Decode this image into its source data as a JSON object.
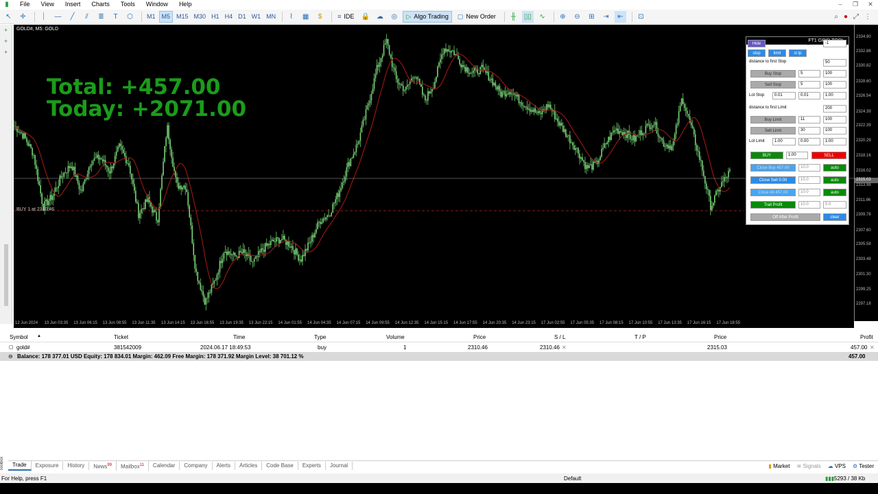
{
  "menu": [
    "File",
    "View",
    "Insert",
    "Charts",
    "Tools",
    "Window",
    "Help"
  ],
  "timeframes": [
    "M1",
    "M5",
    "M15",
    "M30",
    "H1",
    "H4",
    "D1",
    "W1",
    "MN"
  ],
  "active_timeframe": "M5",
  "toolbar": {
    "algo_trading": "Algo Trading",
    "new_order": "New Order",
    "ide": "IDE"
  },
  "chart": {
    "symbol_label": "GOLD#, M5:  GOLD",
    "total": "Total: +457.00",
    "today": "Today: +2071.00",
    "buy_line_label": "BUY 1 at 2310.46",
    "current_price_tag": "2315.03"
  },
  "chart_data": {
    "type": "candlestick",
    "y_ticks": [
      "2334.90",
      "2332.88",
      "2330.82",
      "2328.60",
      "2326.54",
      "2324.39",
      "2322.39",
      "2320.29",
      "2318.16",
      "2316.02",
      "2313.98",
      "2311.86",
      "2309.78",
      "2307.60",
      "2305.58",
      "2303.48",
      "2301.30",
      "2299.25",
      "2297.18"
    ],
    "x_ticks": [
      "12 Jun 2024",
      "13 Jun 03:35",
      "13 Jun 06:15",
      "13 Jun 08:55",
      "13 Jun 11:35",
      "13 Jun 14:15",
      "13 Jun 16:55",
      "13 Jun 19:35",
      "13 Jun 22:15",
      "14 Jun 01:55",
      "14 Jun 04:35",
      "14 Jun 07:15",
      "14 Jun 09:55",
      "14 Jun 12:35",
      "14 Jun 15:15",
      "14 Jun 17:55",
      "14 Jun 20:35",
      "14 Jun 23:15",
      "17 Jun 02:55",
      "17 Jun 05:35",
      "17 Jun 08:15",
      "17 Jun 10:55",
      "17 Jun 13:35",
      "17 Jun 16:15",
      "17 Jun 18:55"
    ],
    "close_path": [
      2322.5,
      2321.0,
      2318.5,
      2311.0,
      2312.5,
      2315.5,
      2317.0,
      2313.0,
      2317.5,
      2318.0,
      2316.0,
      2319.5,
      2317.0,
      2310.0,
      2312.0,
      2309.0,
      2322.5,
      2314.0,
      2314.0,
      2302.0,
      2297.5,
      2300.5,
      2305.0,
      2304.0,
      2304.5,
      2303.0,
      2305.0,
      2306.0,
      2306.5,
      2305.5,
      2303.5,
      2306.0,
      2309.0,
      2310.0,
      2313.0,
      2317.0,
      2320.0,
      2325.0,
      2330.5,
      2334.5,
      2329.0,
      2327.5,
      2330.0,
      2326.0,
      2328.5,
      2333.5,
      2333.0,
      2331.0,
      2330.0,
      2330.5,
      2329.0,
      2327.0,
      2327.5,
      2326.0,
      2325.0,
      2324.0,
      2325.5,
      2323.0,
      2321.0,
      2319.0,
      2316.5,
      2317.0,
      2320.0,
      2322.0,
      2321.5,
      2320.5,
      2322.0,
      2323.0,
      2320.0,
      2319.5,
      2326.5,
      2322.0,
      2317.0,
      2311.0,
      2314.0,
      2316.0
    ],
    "buy_price": 2310.46,
    "current_price": 2315.03
  },
  "panel": {
    "title": "FT1 GRID TOOL",
    "hide": "Hide",
    "magic_label": "Magic:",
    "magic": "-1",
    "tabs": [
      "stop",
      "limit",
      "sl tp"
    ],
    "dist_stop_label": "distance to first Stop",
    "dist_stop": "50",
    "buy_stop": "Buy Stop",
    "buy_stop_n": "5",
    "buy_stop_v": "100",
    "sell_stop": "Sell Stop",
    "sell_stop_n": "5",
    "sell_stop_v": "100",
    "lot_stop_label": "Lot Stop",
    "lot_stop_a": "0.01",
    "lot_stop_b": "0.01",
    "lot_stop_c": "1.00",
    "dist_limit_label": "distance to first Limit",
    "dist_limit": "200",
    "buy_limit": "Buy Limit",
    "buy_limit_n": "11",
    "buy_limit_v": "100",
    "sell_limit": "Sell Limit",
    "sell_limit_n": "30",
    "sell_limit_v": "100",
    "lot_limit_label": "Lot Limit",
    "lot_limit_a": "1.00",
    "lot_limit_b": "0.00",
    "lot_limit_c": "1.00",
    "buy": "BUY",
    "lot": "1.00",
    "sell": "SELL",
    "close_buy": "Close Buy 457.00",
    "close_buy_v": "10.0",
    "auto1": "auto",
    "close_sell": "Close Sell 0.00",
    "close_sell_v": "10.0",
    "auto2": "auto",
    "close_all": "Close All 457.00",
    "close_all_v": "10.0",
    "auto3": "auto",
    "trail": "Trail Profit",
    "trail_v": "10.0",
    "trail_v2": "5.0",
    "off_after": "Off After Profit",
    "clear": "clear"
  },
  "trade": {
    "headers": [
      "Symbol",
      "Ticket",
      "Time",
      "Type",
      "Volume",
      "Price",
      "S / L",
      "T / P",
      "Price",
      "Profit"
    ],
    "row": {
      "symbol": "gold#",
      "ticket": "381542009",
      "time": "2024.06.17 18:49:53",
      "type": "buy",
      "volume": "1",
      "price": "2310.46",
      "sl": "2310.46",
      "tp": "",
      "cur": "2315.03",
      "profit": "457.00"
    },
    "balance": "Balance: 178 377.01 USD  Equity: 178 834.01  Margin: 462.09  Free Margin: 178 371.92  Margin Level: 38 701.12 %",
    "balance_profit": "457.00"
  },
  "tabs": [
    "Trade",
    "Exposure",
    "History",
    "News",
    "Mailbox",
    "Calendar",
    "Company",
    "Alerts",
    "Articles",
    "Code Base",
    "Experts",
    "Journal"
  ],
  "news_badge": "99",
  "mailbox_badge": "11",
  "right_tabs": {
    "market": "Market",
    "signals": "Signals",
    "vps": "VPS",
    "tester": "Tester"
  },
  "toolbox_label": "Toolbox",
  "status": {
    "help": "For Help, press F1",
    "profile": "Default",
    "traffic": "5293 / 38 Kb"
  }
}
